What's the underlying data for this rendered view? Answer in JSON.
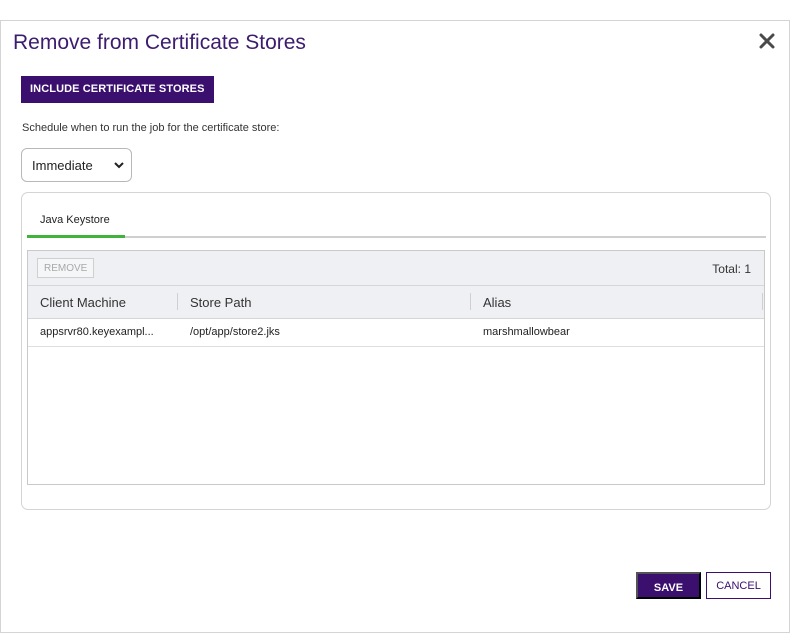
{
  "dialog": {
    "title": "Remove from Certificate Stores",
    "close_icon": "close-icon"
  },
  "toolbar": {
    "include_label": "INCLUDE CERTIFICATE STORES"
  },
  "schedule": {
    "label": "Schedule when to run the job for the certificate store:",
    "selected": "Immediate"
  },
  "tabs": [
    {
      "label": "Java Keystore",
      "active": true
    }
  ],
  "grid": {
    "remove_label": "REMOVE",
    "total_text": "Total: 1",
    "columns": [
      "Client Machine",
      "Store Path",
      "Alias"
    ],
    "rows": [
      {
        "client_machine": "appsrvr80.keyexampl...",
        "store_path": "/opt/app/store2.jks",
        "alias": "marshmallowbear"
      }
    ]
  },
  "footer": {
    "save_label": "SAVE",
    "cancel_label": "CANCEL"
  },
  "colors": {
    "accent": "#3a0f6e",
    "title": "#3b1c6e",
    "tab_active": "#3fb33b"
  }
}
